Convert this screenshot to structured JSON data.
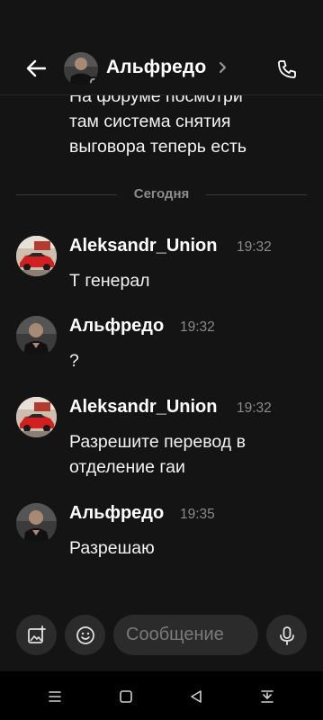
{
  "header": {
    "title": "Альфредо",
    "icons": {
      "back": "arrow-left-icon",
      "chevron": "chevron-right-icon",
      "call": "phone-icon"
    }
  },
  "chat": {
    "previous_message_lines": [
      "На форуме посмотри",
      "там система снятия",
      "выговора теперь есть"
    ],
    "date_separator": "Сегодня",
    "messages": [
      {
        "author": "Aleksandr_Union",
        "time": "19:32",
        "lines": [
          "Т генерал"
        ],
        "avatar": "car-avatar"
      },
      {
        "author": "Альфредо",
        "time": "19:32",
        "lines": [
          "?"
        ],
        "avatar": "person-avatar"
      },
      {
        "author": "Aleksandr_Union",
        "time": "19:32",
        "lines": [
          "Разрешите перевод в",
          "отделение гаи"
        ],
        "avatar": "car-avatar"
      },
      {
        "author": "Альфредо",
        "time": "19:35",
        "lines": [
          "Разрешаю"
        ],
        "avatar": "person-avatar"
      }
    ]
  },
  "composer": {
    "placeholder": "Сообщение",
    "icons": {
      "gallery": "image-add-icon",
      "emoji": "smile-icon",
      "mic": "microphone-icon"
    }
  },
  "system_nav": {
    "icons": [
      "menu-icon",
      "home-square-icon",
      "back-triangle-icon",
      "notification-pull-icon"
    ]
  },
  "colors": {
    "background": "#141414",
    "text": "#ffffff",
    "muted": "#8a8a8a",
    "button": "#2b2b2b"
  }
}
